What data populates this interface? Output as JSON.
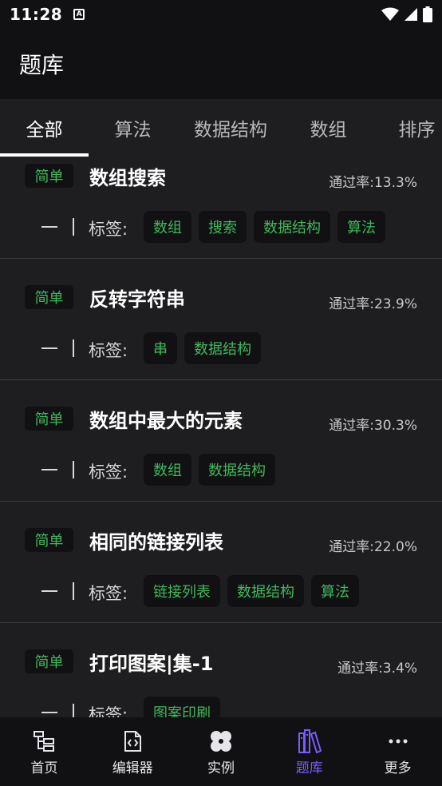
{
  "status_bar": {
    "time": "11:28",
    "notif_letter": "A"
  },
  "app_bar": {
    "title": "题库"
  },
  "tabs": [
    {
      "label": "全部",
      "active": true
    },
    {
      "label": "算法",
      "active": false
    },
    {
      "label": "数据结构",
      "active": false
    },
    {
      "label": "数组",
      "active": false
    },
    {
      "label": "排序",
      "active": false
    }
  ],
  "common": {
    "tag_label": "标签:",
    "dash": "—",
    "bar": "|"
  },
  "problems": [
    {
      "difficulty": "简单",
      "title": "数组搜索",
      "pass_rate": "通过率:13.3%",
      "tags": [
        "数组",
        "搜索",
        "数据结构",
        "算法"
      ]
    },
    {
      "difficulty": "简单",
      "title": "反转字符串",
      "pass_rate": "通过率:23.9%",
      "tags": [
        "串",
        "数据结构"
      ]
    },
    {
      "difficulty": "简单",
      "title": "数组中最大的元素",
      "pass_rate": "通过率:30.3%",
      "tags": [
        "数组",
        "数据结构"
      ]
    },
    {
      "difficulty": "简单",
      "title": "相同的链接列表",
      "pass_rate": "通过率:22.0%",
      "tags": [
        "链接列表",
        "数据结构",
        "算法"
      ]
    },
    {
      "difficulty": "简单",
      "title": "打印图案|集-1",
      "pass_rate": "通过率:3.4%",
      "tags": [
        "图案印刷"
      ]
    }
  ],
  "bottom_nav": [
    {
      "label": "首页",
      "icon": "home-tree-icon",
      "active": false
    },
    {
      "label": "编辑器",
      "icon": "code-file-icon",
      "active": false
    },
    {
      "label": "实例",
      "icon": "clover-icon",
      "active": false
    },
    {
      "label": "题库",
      "icon": "books-icon",
      "active": true,
      "accent": "#7b5cff"
    },
    {
      "label": "更多",
      "icon": "more-dots-icon",
      "active": false
    }
  ],
  "colors": {
    "accent_green": "#3fb95b",
    "accent_purple": "#7b5cff",
    "background": "#1e1e20",
    "bar": "#111113"
  }
}
